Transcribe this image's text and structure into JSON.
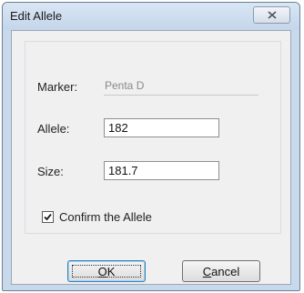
{
  "window": {
    "title": "Edit Allele"
  },
  "form": {
    "marker_label": "Marker:",
    "marker_value": "Penta D",
    "allele_label": "Allele:",
    "allele_value": "182",
    "size_label": "Size:",
    "size_value": "181.7",
    "confirm_label": "Confirm the Allele",
    "confirm_checked": true
  },
  "buttons": {
    "ok_mnemonic": "O",
    "ok_rest": "K",
    "cancel_mnemonic": "C",
    "cancel_rest": "ancel"
  },
  "icons": {
    "close": "close-icon",
    "check": "check-icon"
  },
  "colors": {
    "frame": "#c9d9ec",
    "client": "#f0f0f0",
    "default_button_border": "#3c7fb1"
  }
}
